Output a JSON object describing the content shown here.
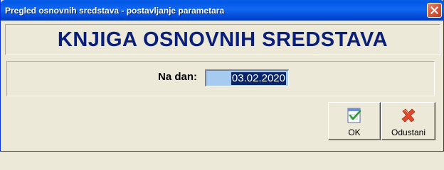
{
  "window": {
    "title": "Pregled osnovnih sredstava - postavljanje parametara"
  },
  "header": {
    "heading": "KNJIGA OSNOVNIH SREDSTAVA"
  },
  "form": {
    "date_label": "Na dan:",
    "date_value": "03.02.2020"
  },
  "buttons": {
    "ok_label": "OK",
    "ok_icon": "check-document-icon",
    "cancel_label": "Odustani",
    "cancel_icon": "red-x-icon"
  },
  "colors": {
    "titlebar": "#0058e6",
    "heading": "#0a1f7a",
    "window_bg": "#ece9d8",
    "date_field_bg": "#a6caf0",
    "selection_bg": "#0a246a"
  }
}
